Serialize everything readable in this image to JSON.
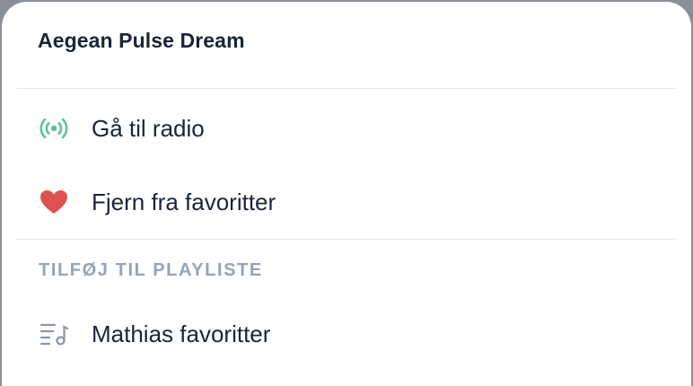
{
  "sheet": {
    "title": "Aegean Pulse Dream"
  },
  "menu": {
    "go_to_radio": {
      "label": "Gå til radio",
      "icon": "radio-broadcast-icon",
      "color": "#5cc1a3"
    },
    "remove_favorite": {
      "label": "Fjern fra favoritter",
      "icon": "heart-icon",
      "color": "#e0524f"
    }
  },
  "playlists": {
    "section_label": "TILFØJ TIL PLAYLISTE",
    "items": [
      {
        "label": "Mathias favoritter",
        "icon": "playlist-icon"
      }
    ]
  }
}
